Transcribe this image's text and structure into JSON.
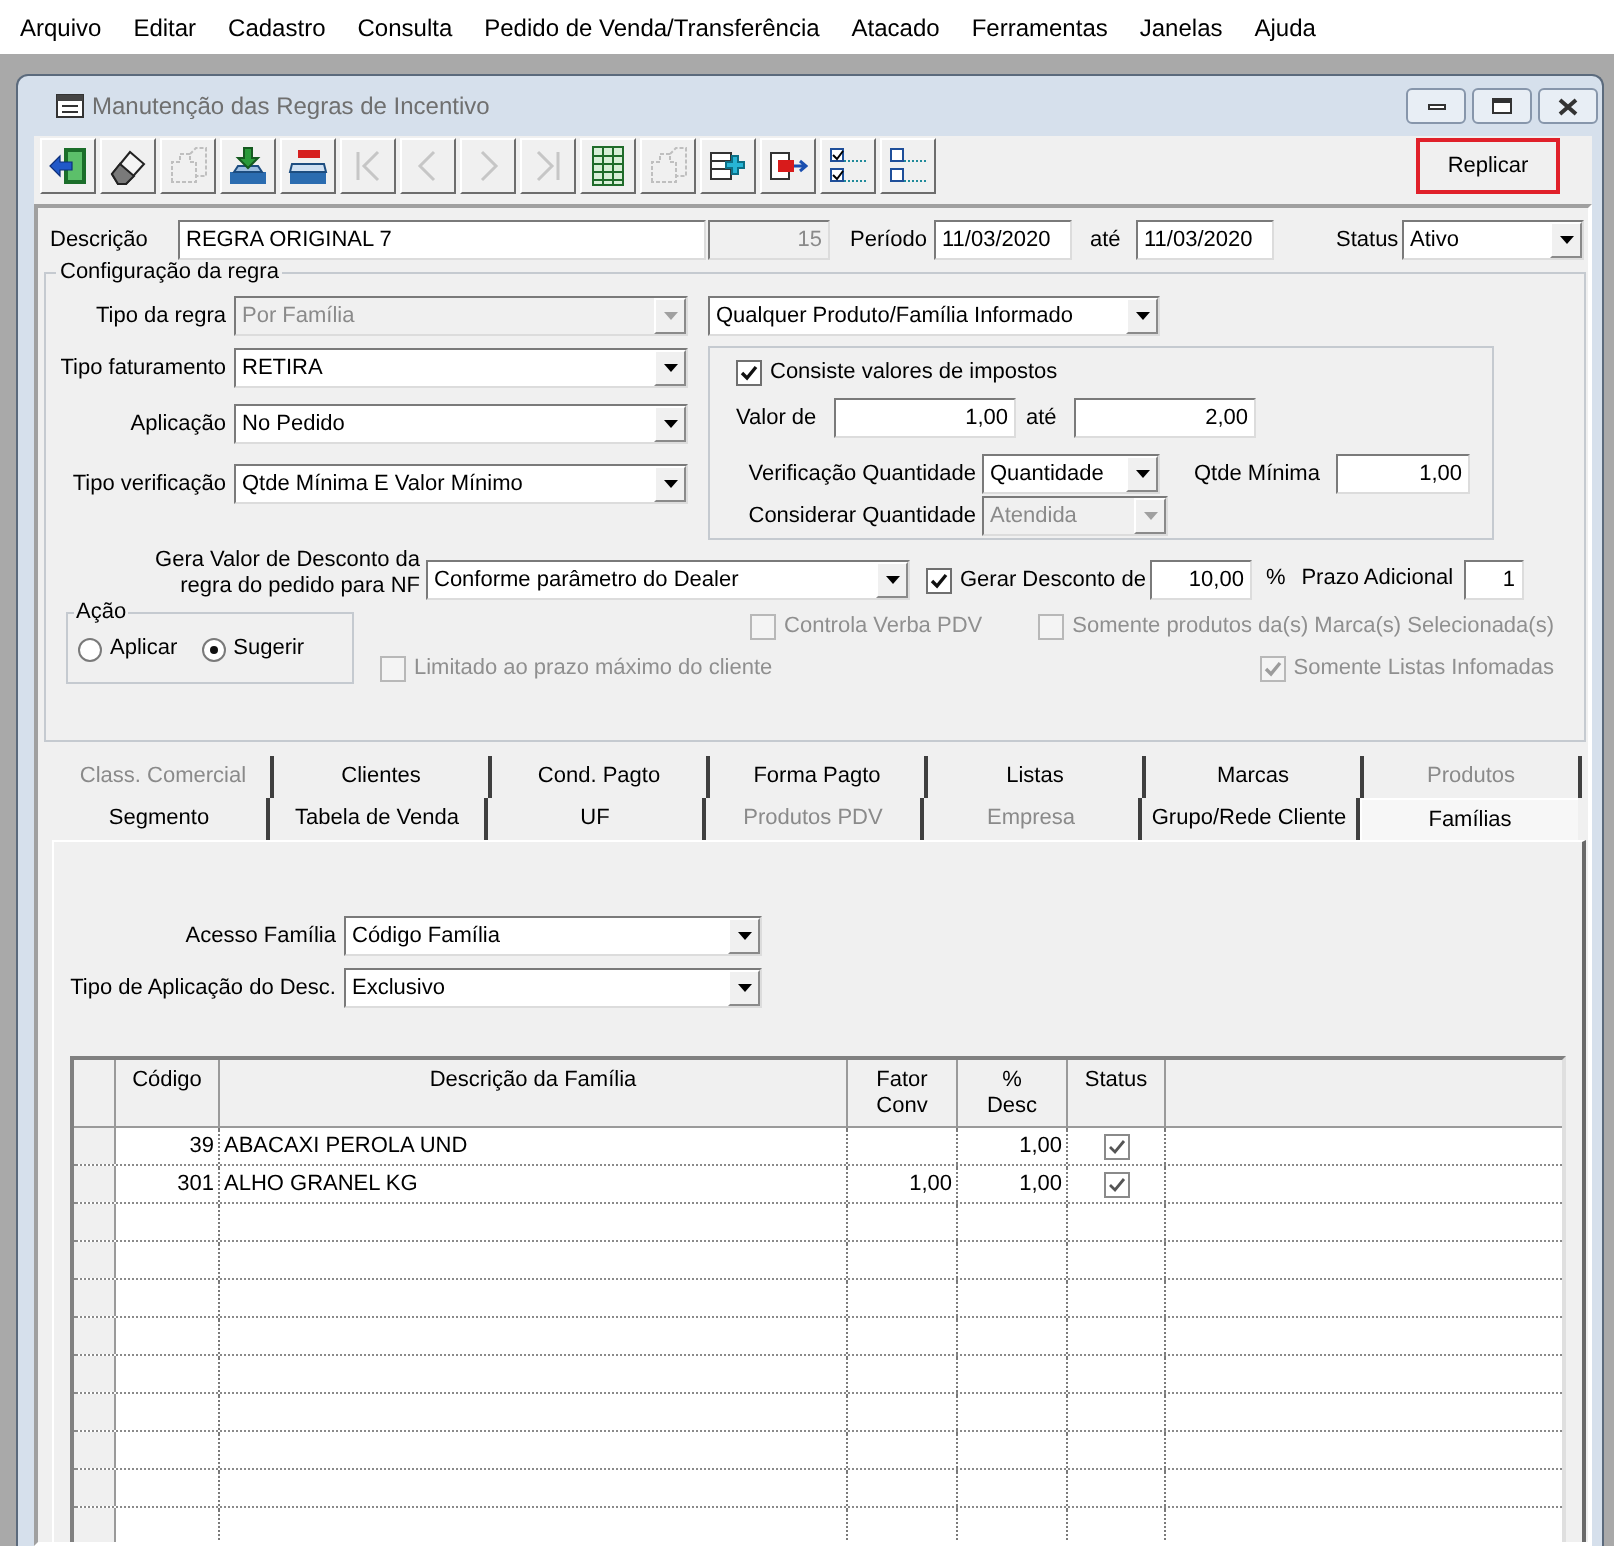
{
  "menu": [
    "Arquivo",
    "Editar",
    "Cadastro",
    "Consulta",
    "Pedido de Venda/Transferência",
    "Atacado",
    "Ferramentas",
    "Janelas",
    "Ajuda"
  ],
  "window": {
    "title": "Manutenção das Regras de Incentivo"
  },
  "toolbar": [
    {
      "disabled": false
    },
    {
      "disabled": false
    },
    {
      "disabled": true
    },
    {
      "disabled": false
    },
    {
      "disabled": false
    },
    {
      "disabled": true
    },
    {
      "disabled": true
    },
    {
      "disabled": true
    },
    {
      "disabled": true
    },
    {
      "disabled": false
    },
    {
      "disabled": true
    },
    {
      "disabled": false
    },
    {
      "disabled": false
    },
    {
      "disabled": false
    },
    {
      "disabled": false
    }
  ],
  "replicar_button": {
    "label": "Replicar",
    "highlighted": true
  },
  "header": {
    "descricao": {
      "label": "Descrição",
      "value": "REGRA ORIGINAL 7"
    },
    "numero": {
      "value": "15",
      "disabled": true
    },
    "periodo": {
      "label": "Período",
      "from": "11/03/2020",
      "separator": "até",
      "to": "11/03/2020"
    },
    "status": {
      "label": "Status",
      "value": "Ativo",
      "disabled": false
    }
  },
  "config": {
    "title": "Configuração da regra",
    "tipo_regra": {
      "label": "Tipo da regra",
      "value": "Por Família",
      "disabled": true
    },
    "tipo_regra_2": {
      "value": "Qualquer Produto/Família Informado",
      "disabled": false
    },
    "tipo_faturamento": {
      "label": "Tipo faturamento",
      "value": "RETIRA",
      "disabled": false
    },
    "aplicacao": {
      "label": "Aplicação",
      "value": "No Pedido",
      "disabled": false
    },
    "tipo_verificacao": {
      "label": "Tipo verificação",
      "value": "Qtde Mínima E Valor Mínimo",
      "disabled": false
    },
    "impostos": {
      "consiste": {
        "label": "Consiste valores de impostos",
        "checked": true,
        "disabled": false
      },
      "valor_de": {
        "label": "Valor de",
        "value": "1,00"
      },
      "valor_ate": {
        "label": "até",
        "value": "2,00"
      },
      "verificacao_quantidade": {
        "label": "Verificação Quantidade",
        "value": "Quantidade",
        "disabled": false
      },
      "qtde_minima": {
        "label": "Qtde Mínima",
        "value": "1,00"
      },
      "considerar_quantidade": {
        "label": "Considerar Quantidade",
        "value": "Atendida",
        "disabled": true
      }
    },
    "gera_valor": {
      "label": "Gera Valor de Desconto da regra do pedido para NF",
      "value": "Conforme parâmetro do Dealer",
      "disabled": false
    },
    "gerar_desconto": {
      "label": "Gerar Desconto de",
      "checked": true,
      "disabled": false,
      "value": "10,00",
      "unit": "%"
    },
    "prazo_adicional": {
      "label": "Prazo Adicional",
      "value": "1"
    },
    "acao": {
      "title": "Ação",
      "options": [
        {
          "label": "Aplicar",
          "selected": false
        },
        {
          "label": "Sugerir",
          "selected": true
        }
      ]
    },
    "controla_verba": {
      "label": "Controla Verba PDV",
      "checked": false,
      "disabled": true
    },
    "somente_marcas": {
      "label": "Somente produtos da(s) Marca(s) Selecionada(s)",
      "checked": false,
      "disabled": true
    },
    "limitado_prazo": {
      "label": "Limitado ao prazo máximo do cliente",
      "checked": false,
      "disabled": true
    },
    "somente_listas": {
      "label": "Somente Listas Infomadas",
      "checked": true,
      "disabled": true
    }
  },
  "tabs": {
    "rows": [
      {
        "tabs": [
          {
            "label": "Class. Comercial",
            "selected": false,
            "disabled": true
          },
          {
            "label": "Clientes",
            "selected": false,
            "disabled": false
          },
          {
            "label": "Cond. Pagto",
            "selected": false,
            "disabled": false
          },
          {
            "label": "Forma Pagto",
            "selected": false,
            "disabled": false
          },
          {
            "label": "Listas",
            "selected": false,
            "disabled": false
          },
          {
            "label": "Marcas",
            "selected": false,
            "disabled": false
          },
          {
            "label": "Produtos",
            "selected": false,
            "disabled": true
          }
        ]
      },
      {
        "tabs": [
          {
            "label": "Segmento",
            "selected": false,
            "disabled": false
          },
          {
            "label": "Tabela de Venda",
            "selected": false,
            "disabled": false
          },
          {
            "label": "UF",
            "selected": false,
            "disabled": false
          },
          {
            "label": "Produtos PDV",
            "selected": false,
            "disabled": true
          },
          {
            "label": "Empresa",
            "selected": false,
            "disabled": true
          },
          {
            "label": "Grupo/Rede Cliente",
            "selected": false,
            "disabled": false
          },
          {
            "label": "Famílias",
            "selected": true,
            "disabled": false
          }
        ]
      }
    ]
  },
  "familias": {
    "acesso_familia": {
      "label": "Acesso Família",
      "value": "Código Família",
      "disabled": false
    },
    "tipo_aplicacao": {
      "label": "Tipo de Aplicação do Desc.",
      "value": "Exclusivo",
      "disabled": false
    },
    "table": {
      "columns": [
        "Código",
        "Descrição da Família",
        "Fator Conv",
        "% Desc",
        "Status"
      ],
      "rows": [
        {
          "codigo": "39",
          "descricao": "ABACAXI PEROLA UND",
          "desc": "1,00",
          "status": true
        },
        {
          "codigo": "301",
          "descricao": "ALHO GRANEL KG",
          "fator_conv": "1,00",
          "desc": "1,00",
          "status": true
        }
      ]
    }
  }
}
